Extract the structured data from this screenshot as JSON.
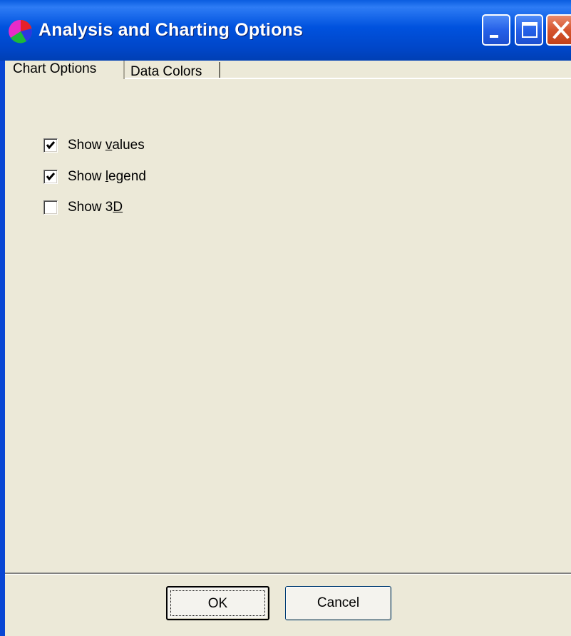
{
  "window": {
    "title": "Analysis and Charting Options",
    "icon": "pie-chart-icon"
  },
  "tabs": [
    {
      "label": "Chart Options",
      "active": true
    },
    {
      "label": "Data Colors",
      "active": false
    }
  ],
  "options": [
    {
      "label_pre": "Show ",
      "label_key": "v",
      "label_post": "alues",
      "checked": true
    },
    {
      "label_pre": "Show ",
      "label_key": "l",
      "label_post": "egend",
      "checked": true
    },
    {
      "label_pre": "Show 3",
      "label_key": "D",
      "label_post": "",
      "checked": false
    }
  ],
  "buttons": {
    "ok": "OK",
    "cancel": "Cancel"
  },
  "colors": {
    "titlebar": "#0052DE",
    "close_button": "#D6552E",
    "face": "#ECE9D8"
  }
}
